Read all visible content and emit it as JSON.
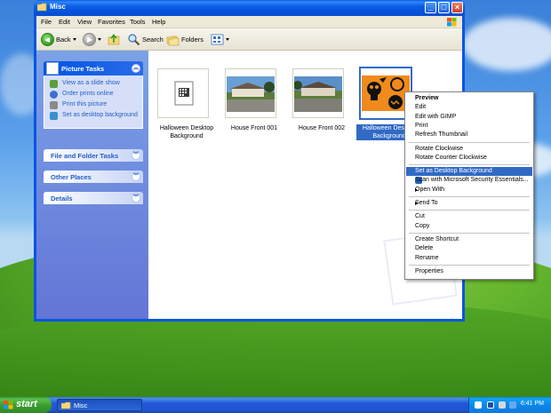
{
  "window": {
    "title": "Misc",
    "menu": [
      "File",
      "Edit",
      "View",
      "Favorites",
      "Tools",
      "Help"
    ],
    "toolbar": {
      "back": "Back",
      "search": "Search",
      "folders": "Folders"
    }
  },
  "taskpane": {
    "picture_tasks": {
      "title": "Picture Tasks",
      "links": [
        "View as a slide show",
        "Order prints online",
        "Print this picture",
        "Set as desktop background"
      ]
    },
    "sections": [
      "File and Folder Tasks",
      "Other Places",
      "Details"
    ]
  },
  "files": [
    {
      "label": "Halloween Desktop Background",
      "kind": "document"
    },
    {
      "label": "House Front 001",
      "kind": "photo"
    },
    {
      "label": "House Front 002",
      "kind": "photo"
    },
    {
      "label": "Halloween Desktop Background",
      "kind": "halloween",
      "selected": true
    }
  ],
  "context_menu": {
    "items": [
      {
        "label": "Preview",
        "bold": true
      },
      {
        "label": "Edit"
      },
      {
        "label": "Edit with GIMP"
      },
      {
        "label": "Print"
      },
      {
        "label": "Refresh Thumbnail"
      },
      {
        "sep": true
      },
      {
        "label": "Rotate Clockwise"
      },
      {
        "label": "Rotate Counter Clockwise"
      },
      {
        "sep": true
      },
      {
        "label": "Set as Desktop Background",
        "highlight": true
      },
      {
        "label": "Scan with Microsoft Security Essentials...",
        "icon": "shield-icon"
      },
      {
        "label": "Open With",
        "submenu": true
      },
      {
        "sep": true
      },
      {
        "label": "Send To",
        "submenu": true
      },
      {
        "sep": true
      },
      {
        "label": "Cut"
      },
      {
        "label": "Copy"
      },
      {
        "sep": true
      },
      {
        "label": "Create Shortcut"
      },
      {
        "label": "Delete"
      },
      {
        "label": "Rename"
      },
      {
        "sep": true
      },
      {
        "label": "Properties"
      }
    ]
  },
  "taskbar": {
    "start_label": "start",
    "task_label": "Misc",
    "clock": "6:41 PM"
  },
  "colors": {
    "selection": "#316ac5",
    "title_blue": "#0a55e0",
    "taskpane_link": "#215dc6"
  }
}
